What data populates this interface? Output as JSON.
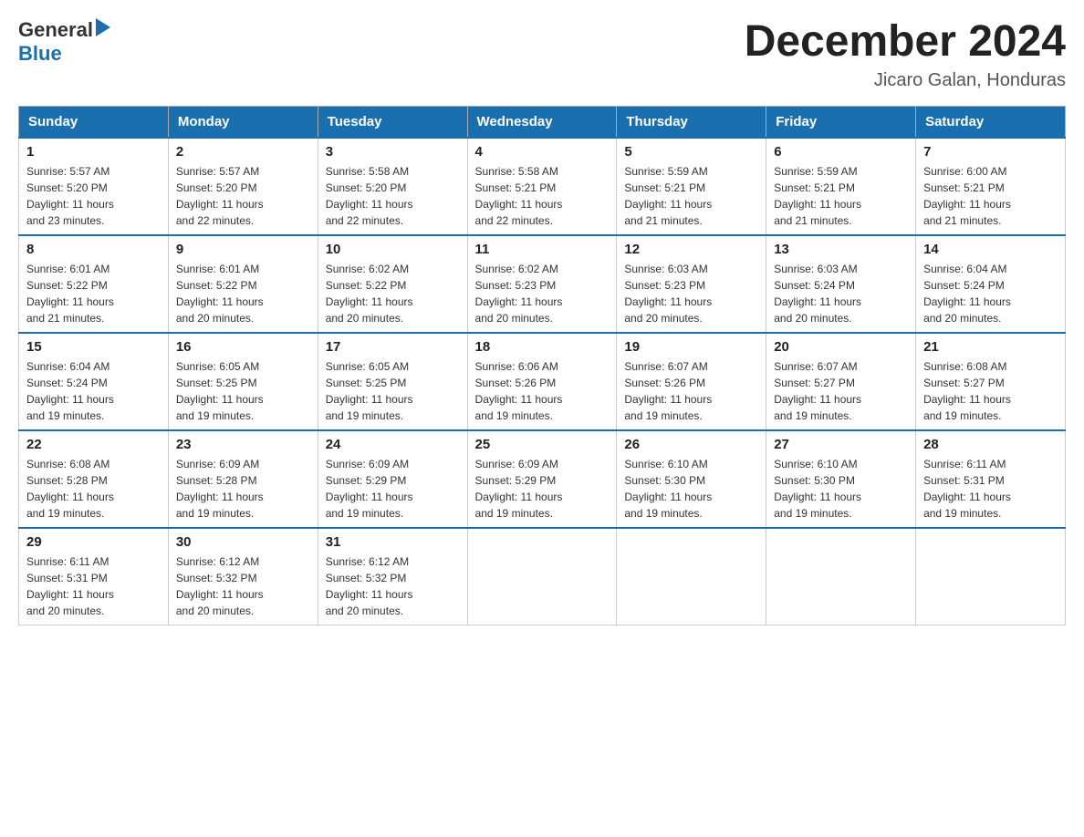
{
  "logo": {
    "general": "General",
    "blue": "Blue"
  },
  "header": {
    "month": "December 2024",
    "location": "Jicaro Galan, Honduras"
  },
  "weekdays": [
    "Sunday",
    "Monday",
    "Tuesday",
    "Wednesday",
    "Thursday",
    "Friday",
    "Saturday"
  ],
  "weeks": [
    [
      {
        "day": "1",
        "sunrise": "5:57 AM",
        "sunset": "5:20 PM",
        "daylight": "11 hours and 23 minutes."
      },
      {
        "day": "2",
        "sunrise": "5:57 AM",
        "sunset": "5:20 PM",
        "daylight": "11 hours and 22 minutes."
      },
      {
        "day": "3",
        "sunrise": "5:58 AM",
        "sunset": "5:20 PM",
        "daylight": "11 hours and 22 minutes."
      },
      {
        "day": "4",
        "sunrise": "5:58 AM",
        "sunset": "5:21 PM",
        "daylight": "11 hours and 22 minutes."
      },
      {
        "day": "5",
        "sunrise": "5:59 AM",
        "sunset": "5:21 PM",
        "daylight": "11 hours and 21 minutes."
      },
      {
        "day": "6",
        "sunrise": "5:59 AM",
        "sunset": "5:21 PM",
        "daylight": "11 hours and 21 minutes."
      },
      {
        "day": "7",
        "sunrise": "6:00 AM",
        "sunset": "5:21 PM",
        "daylight": "11 hours and 21 minutes."
      }
    ],
    [
      {
        "day": "8",
        "sunrise": "6:01 AM",
        "sunset": "5:22 PM",
        "daylight": "11 hours and 21 minutes."
      },
      {
        "day": "9",
        "sunrise": "6:01 AM",
        "sunset": "5:22 PM",
        "daylight": "11 hours and 20 minutes."
      },
      {
        "day": "10",
        "sunrise": "6:02 AM",
        "sunset": "5:22 PM",
        "daylight": "11 hours and 20 minutes."
      },
      {
        "day": "11",
        "sunrise": "6:02 AM",
        "sunset": "5:23 PM",
        "daylight": "11 hours and 20 minutes."
      },
      {
        "day": "12",
        "sunrise": "6:03 AM",
        "sunset": "5:23 PM",
        "daylight": "11 hours and 20 minutes."
      },
      {
        "day": "13",
        "sunrise": "6:03 AM",
        "sunset": "5:24 PM",
        "daylight": "11 hours and 20 minutes."
      },
      {
        "day": "14",
        "sunrise": "6:04 AM",
        "sunset": "5:24 PM",
        "daylight": "11 hours and 20 minutes."
      }
    ],
    [
      {
        "day": "15",
        "sunrise": "6:04 AM",
        "sunset": "5:24 PM",
        "daylight": "11 hours and 19 minutes."
      },
      {
        "day": "16",
        "sunrise": "6:05 AM",
        "sunset": "5:25 PM",
        "daylight": "11 hours and 19 minutes."
      },
      {
        "day": "17",
        "sunrise": "6:05 AM",
        "sunset": "5:25 PM",
        "daylight": "11 hours and 19 minutes."
      },
      {
        "day": "18",
        "sunrise": "6:06 AM",
        "sunset": "5:26 PM",
        "daylight": "11 hours and 19 minutes."
      },
      {
        "day": "19",
        "sunrise": "6:07 AM",
        "sunset": "5:26 PM",
        "daylight": "11 hours and 19 minutes."
      },
      {
        "day": "20",
        "sunrise": "6:07 AM",
        "sunset": "5:27 PM",
        "daylight": "11 hours and 19 minutes."
      },
      {
        "day": "21",
        "sunrise": "6:08 AM",
        "sunset": "5:27 PM",
        "daylight": "11 hours and 19 minutes."
      }
    ],
    [
      {
        "day": "22",
        "sunrise": "6:08 AM",
        "sunset": "5:28 PM",
        "daylight": "11 hours and 19 minutes."
      },
      {
        "day": "23",
        "sunrise": "6:09 AM",
        "sunset": "5:28 PM",
        "daylight": "11 hours and 19 minutes."
      },
      {
        "day": "24",
        "sunrise": "6:09 AM",
        "sunset": "5:29 PM",
        "daylight": "11 hours and 19 minutes."
      },
      {
        "day": "25",
        "sunrise": "6:09 AM",
        "sunset": "5:29 PM",
        "daylight": "11 hours and 19 minutes."
      },
      {
        "day": "26",
        "sunrise": "6:10 AM",
        "sunset": "5:30 PM",
        "daylight": "11 hours and 19 minutes."
      },
      {
        "day": "27",
        "sunrise": "6:10 AM",
        "sunset": "5:30 PM",
        "daylight": "11 hours and 19 minutes."
      },
      {
        "day": "28",
        "sunrise": "6:11 AM",
        "sunset": "5:31 PM",
        "daylight": "11 hours and 19 minutes."
      }
    ],
    [
      {
        "day": "29",
        "sunrise": "6:11 AM",
        "sunset": "5:31 PM",
        "daylight": "11 hours and 20 minutes."
      },
      {
        "day": "30",
        "sunrise": "6:12 AM",
        "sunset": "5:32 PM",
        "daylight": "11 hours and 20 minutes."
      },
      {
        "day": "31",
        "sunrise": "6:12 AM",
        "sunset": "5:32 PM",
        "daylight": "11 hours and 20 minutes."
      },
      null,
      null,
      null,
      null
    ]
  ],
  "labels": {
    "sunrise": "Sunrise:",
    "sunset": "Sunset:",
    "daylight": "Daylight:"
  }
}
